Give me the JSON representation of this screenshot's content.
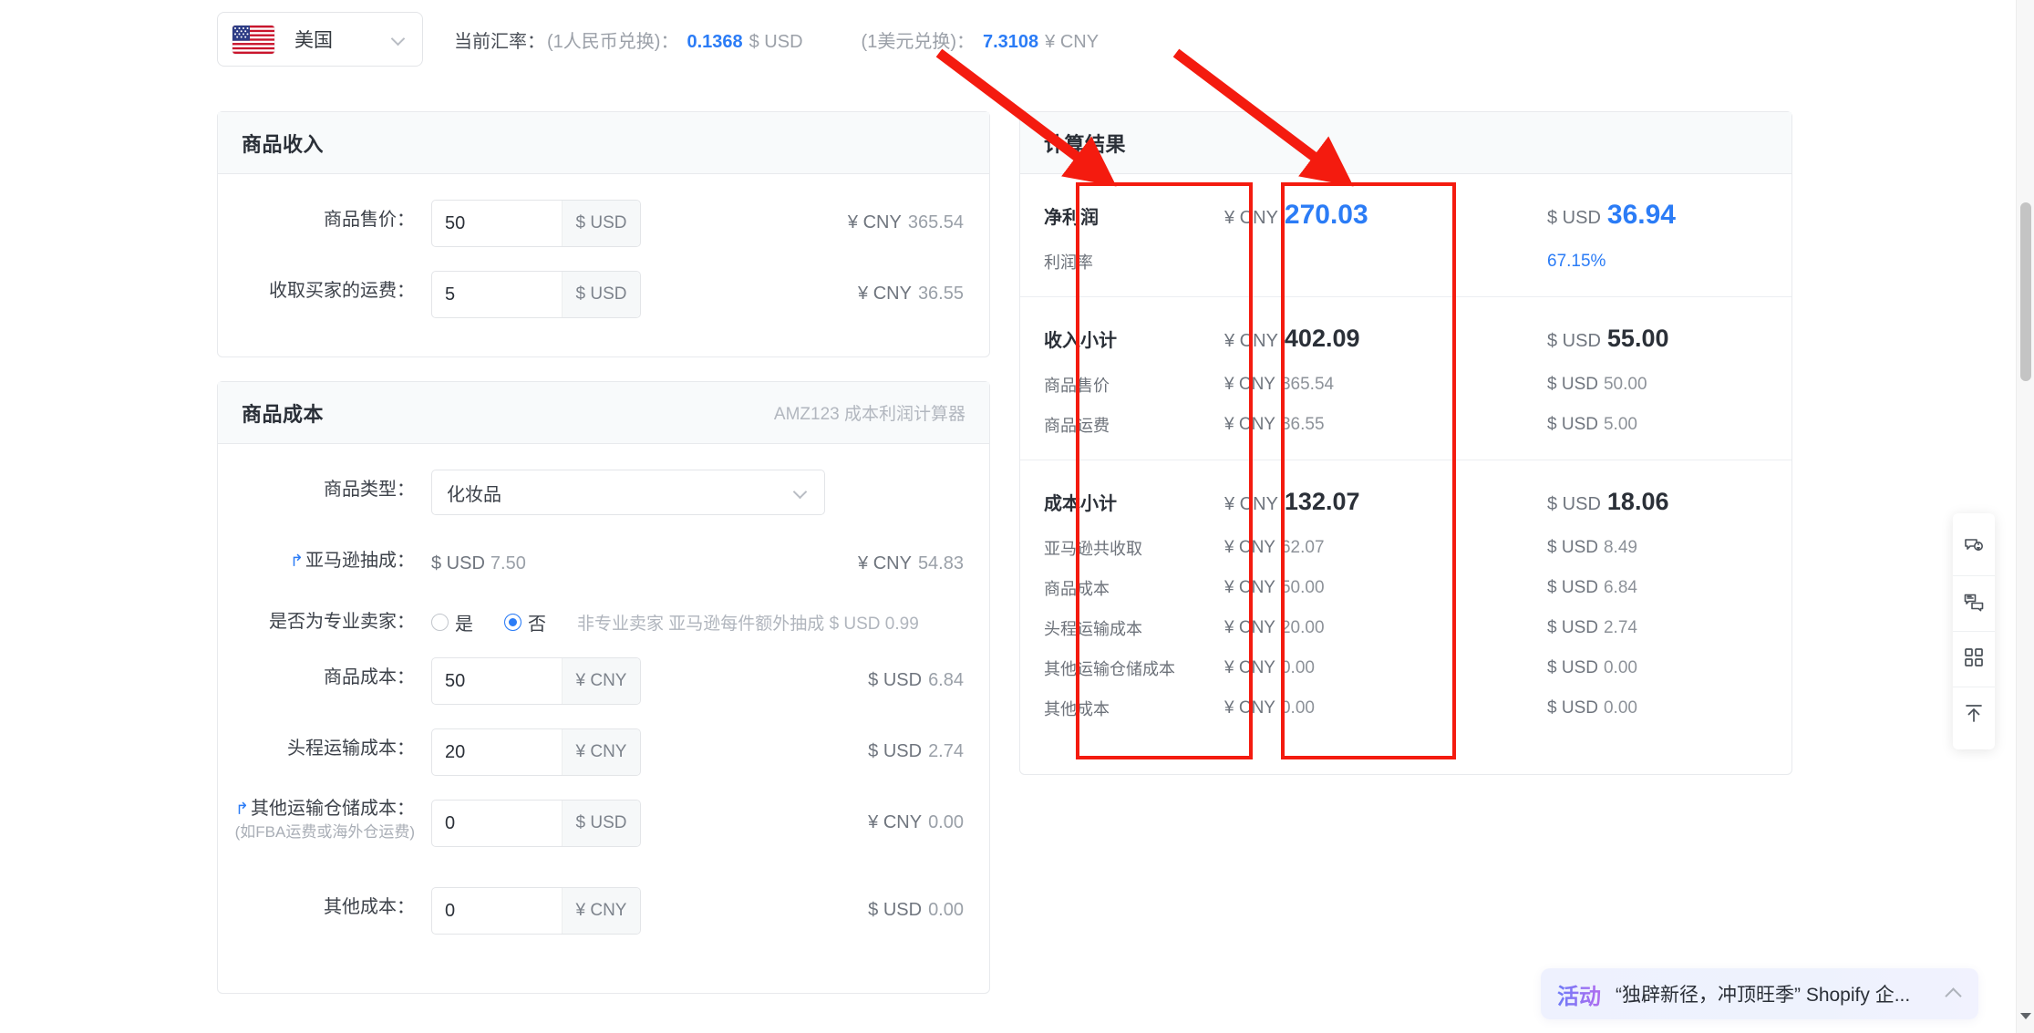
{
  "exchange": {
    "country": "美国",
    "flag_icon": "us-flag-icon",
    "rate_label": "当前汇率：",
    "cny_to_usd_paren": "(1人民币兑换)：",
    "cny_to_usd_value": "0.1368",
    "cny_to_usd_unit": "$ USD",
    "usd_to_cny_paren": "(1美元兑换)：",
    "usd_to_cny_value": "7.3108",
    "usd_to_cny_unit": "¥ CNY"
  },
  "income_card": {
    "title": "商品收入",
    "rows": [
      {
        "label": "商品售价：",
        "value": "50",
        "addon": "$ USD",
        "right_cur": "¥ CNY",
        "right_num": "365.54"
      },
      {
        "label": "收取买家的运费：",
        "value": "5",
        "addon": "$ USD",
        "right_cur": "¥ CNY",
        "right_num": "36.55"
      }
    ]
  },
  "cost_card": {
    "title": "商品成本",
    "subtitle": "AMZ123 成本利润计算器",
    "product_type": {
      "label": "商品类型：",
      "value": "化妆品"
    },
    "amazon_fee": {
      "label": "亚马逊抽成：",
      "link_icon": "external-link-icon",
      "cur": "$ USD",
      "num": "7.50",
      "right_cur": "¥ CNY",
      "right_num": "54.83"
    },
    "pro_seller": {
      "label": "是否为专业卖家：",
      "option_yes": "是",
      "option_no": "否",
      "selected": "否",
      "note": "非专业卖家 亚马逊每件额外抽成",
      "note_amount": "$ USD 0.99"
    },
    "rows": [
      {
        "label": "商品成本：",
        "value": "50",
        "addon": "¥ CNY",
        "right_cur": "$ USD",
        "right_num": "6.84"
      },
      {
        "label": "头程运输成本：",
        "value": "20",
        "addon": "¥ CNY",
        "right_cur": "$ USD",
        "right_num": "2.74"
      },
      {
        "label": "其他运输仓储成本：",
        "hint": "(如FBA运费或海外仓运费)",
        "link_icon": "external-link-icon",
        "value": "0",
        "addon": "$ USD",
        "right_cur": "¥ CNY",
        "right_num": "0.00"
      },
      {
        "label": "其他成本：",
        "value": "0",
        "addon": "¥ CNY",
        "right_cur": "$ USD",
        "right_num": "0.00"
      }
    ]
  },
  "result_card": {
    "title": "计算结果",
    "sections": [
      {
        "major": {
          "name": "净利润",
          "cny_cur": "¥ CNY",
          "cny_num": "270.03",
          "usd_cur": "$ USD",
          "usd_num": "36.94"
        },
        "minors": [
          {
            "name": "利润率",
            "cny": "",
            "usd": "67.15%",
            "usd_is_pct": true
          }
        ]
      },
      {
        "major": {
          "name": "收入小计",
          "cny_cur": "¥ CNY",
          "cny_num": "402.09",
          "usd_cur": "$ USD",
          "usd_num": "55.00"
        },
        "minors": [
          {
            "name": "商品售价",
            "cny_cur": "¥ CNY",
            "cny_num": "365.54",
            "usd_cur": "$ USD",
            "usd_num": "50.00"
          },
          {
            "name": "商品运费",
            "cny_cur": "¥ CNY",
            "cny_num": "36.55",
            "usd_cur": "$ USD",
            "usd_num": "5.00"
          }
        ]
      },
      {
        "major": {
          "name": "成本小计",
          "cny_cur": "¥ CNY",
          "cny_num": "132.07",
          "usd_cur": "$ USD",
          "usd_num": "18.06"
        },
        "minors": [
          {
            "name": "亚马逊共收取",
            "cny_cur": "¥ CNY",
            "cny_num": "62.07",
            "usd_cur": "$ USD",
            "usd_num": "8.49"
          },
          {
            "name": "商品成本",
            "cny_cur": "¥ CNY",
            "cny_num": "50.00",
            "usd_cur": "$ USD",
            "usd_num": "6.84"
          },
          {
            "name": "头程运输成本",
            "cny_cur": "¥ CNY",
            "cny_num": "20.00",
            "usd_cur": "$ USD",
            "usd_num": "2.74"
          },
          {
            "name": "其他运输仓储成本",
            "cny_cur": "¥ CNY",
            "cny_num": "0.00",
            "usd_cur": "$ USD",
            "usd_num": "0.00"
          },
          {
            "name": "其他成本",
            "cny_cur": "¥ CNY",
            "cny_num": "0.00",
            "usd_cur": "$ USD",
            "usd_num": "0.00"
          }
        ]
      }
    ]
  },
  "right_rail": {
    "items": [
      {
        "icon": "feedback-idea-icon"
      },
      {
        "icon": "chat-bubbles-icon"
      },
      {
        "icon": "qr-code-icon"
      },
      {
        "icon": "back-to-top-icon"
      }
    ]
  },
  "promo": {
    "tag": "活动",
    "text": "“独辟新径，冲顶旺季” Shopify 企...",
    "collapse_icon": "chevron-up-icon"
  },
  "colors": {
    "accent_blue": "#2b7cf6",
    "annotation_red": "#f41b0f",
    "card_header_bg": "#f8fafb",
    "border": "#e8eaed"
  }
}
